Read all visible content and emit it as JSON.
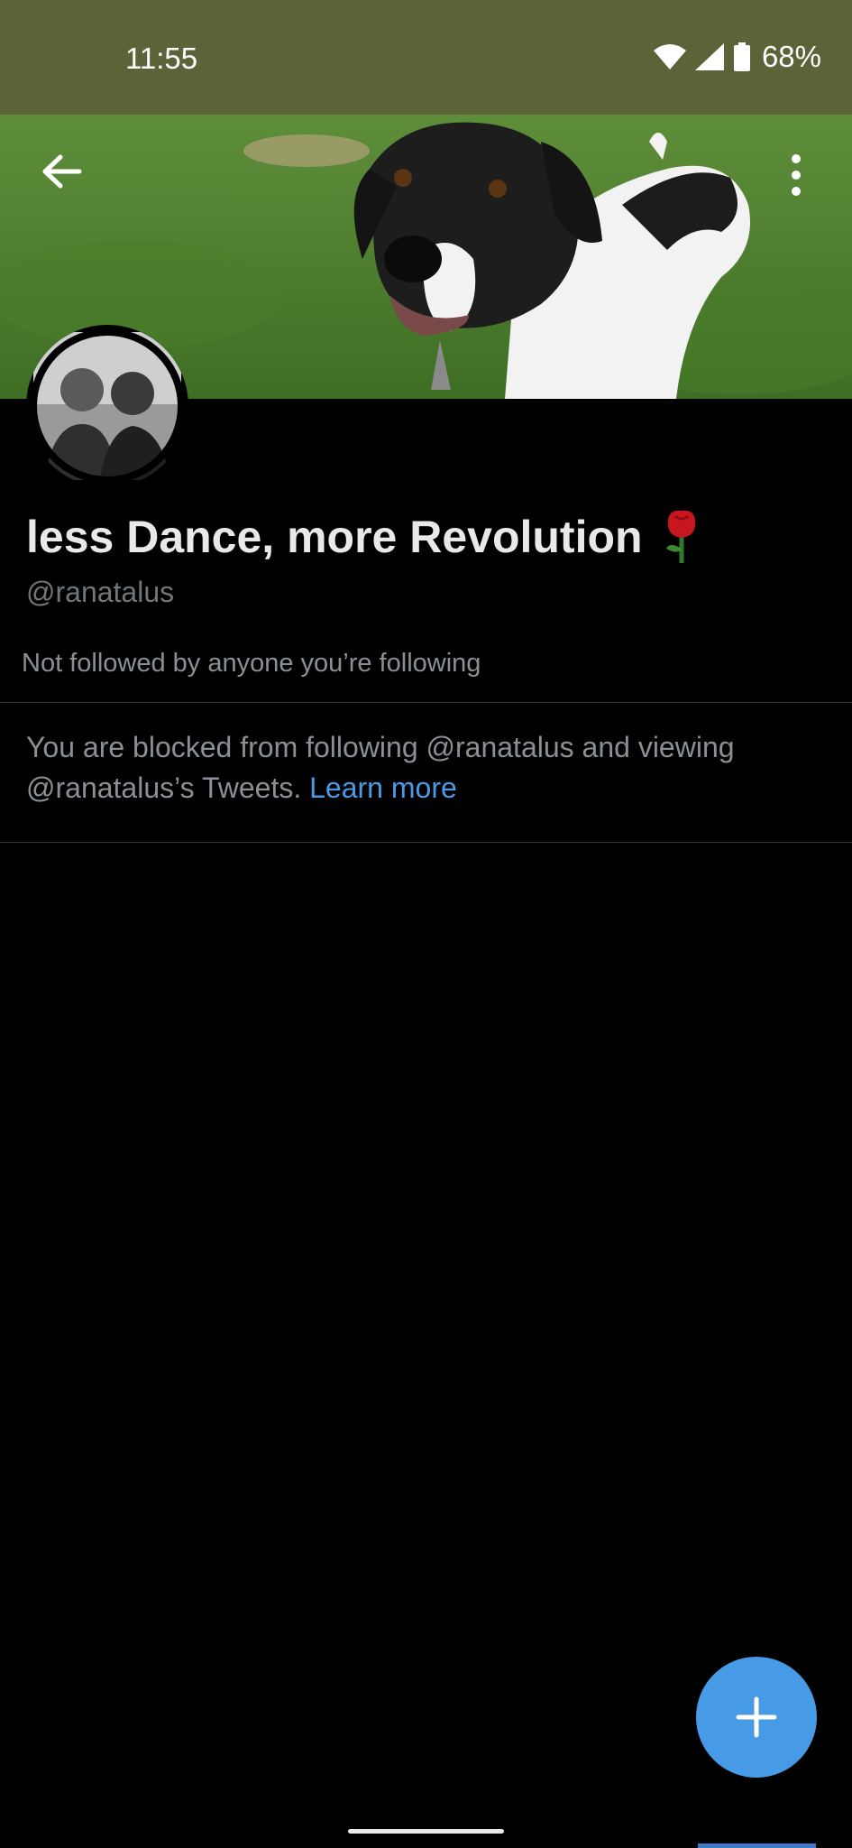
{
  "status_bar": {
    "time": "11:55",
    "battery": "68%",
    "icons": [
      "wifi-icon",
      "signal-icon",
      "battery-icon"
    ],
    "background": "#5b6338"
  },
  "header": {
    "back_icon": "arrow-left-icon",
    "more_icon": "more-vertical-icon"
  },
  "profile": {
    "display_name": "less Dance, more Revolution",
    "name_emoji_icon": "rose-icon",
    "handle": "@ranatalus",
    "followed_by": "Not followed by anyone you’re following"
  },
  "blocked_notice": {
    "text": "You are blocked from following @ranatalus and viewing @ranatalus’s Tweets.",
    "link_label": "Learn more",
    "link_color": "#4a9ae6"
  },
  "fab": {
    "icon": "plus-icon",
    "color": "#479ae6"
  }
}
